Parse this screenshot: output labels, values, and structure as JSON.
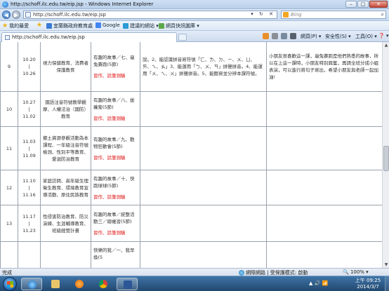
{
  "window": {
    "title": "http://schoff.ilc.edu.tw/eip.jsp - Windows Internet Explorer",
    "minimize": "–",
    "maximize": "□",
    "close": "✕"
  },
  "address_bar": {
    "url": "http://schoff.ilc.edu.tw/eip.jsp",
    "arrows": "▾ ↻ ✕",
    "search_placeholder": "Bing",
    "search_icon": "magnifier-icon"
  },
  "favorites_bar": {
    "favorites_label": "我的最愛",
    "items": [
      "宜蘭縣政府教育處",
      "Google",
      "建議的網站 ▾",
      "網頁快訊圖庫 ▾"
    ]
  },
  "tab": {
    "label": "http://schoff.ilc.edu.tw/eip.jsp"
  },
  "command_bar": {
    "page": "網頁(P) ▾",
    "safety": "安全性(S) ▾",
    "tools": "工具(O) ▾",
    "help": "❓ ▾"
  },
  "table": {
    "rows": [
      {
        "week": "9",
        "date_start": "10.20",
        "date_sep": "|",
        "date_end": "10.26",
        "topic": "視力保健教育、消費者保護教育",
        "unit": "有趣的故事／七、龜兔賽跑(5節)",
        "mark": "習作、話筆測驗",
        "notes": "說。2、能認識拼音寫符號「ㄈ、ㄌ、ㄉ、ㄧ、ㄨ、ㄩ、ㄞ、ㄟ、ㄠ」3、能運用「ㄅ、ㄨ、ㄢ」拼聲拼音。4、能運用「ㄨ、ㄟ、ㄨ」拼聲拼音。5、能聽寫並分辨本課符號。",
        "remark": "小朋友很喜歡這一課，龜兔賽跑是他們熟悉的故事，所以在上這一課時，小朋友特別興奮，再請全班分成小組表演，可以進行將句子寫出，希望小朋友與老師一起加油!"
      },
      {
        "week": "10",
        "date_start": "10.27",
        "date_sep": "|",
        "date_end": "11.02",
        "topic": "國語注音符號教學觀摩、人權法治（國防）教育",
        "unit": "有趣的故事／八、拔蘿蔔(5節)",
        "mark": "習作、話筆測驗",
        "notes": "",
        "remark": ""
      },
      {
        "week": "11",
        "date_start": "11.03",
        "date_sep": "|",
        "date_end": "11.09",
        "topic": "鄉土資源參觀活動為本課程、一年級注音符號檢測、性別平等教育、愛滋防治教育",
        "unit": "有趣的故事／九、動物狂歡會(5節)",
        "mark": "習作、話筆測驗",
        "notes": "",
        "remark": ""
      },
      {
        "week": "12",
        "date_start": "11.10",
        "date_sep": "|",
        "date_end": "11.16",
        "topic": "家庭訪問、高年級生理衛生教育、環境教育宣導活動、原住民族教育",
        "unit": "有趣的故事／十、快跑球球(5節)",
        "mark": "習作、話筆測驗",
        "notes": "",
        "remark": ""
      },
      {
        "week": "13",
        "date_start": "11.17",
        "date_sep": "|",
        "date_end": "11.23",
        "topic": "性侵害防治教育、防災演練、生涯輔導教育、班級經營計畫",
        "unit": "有趣的故事／統整活動三／總複習(5節)",
        "mark": "習作、話筆測驗",
        "notes": "",
        "remark": ""
      },
      {
        "week": "",
        "date_start": "",
        "date_sep": "",
        "date_end": "",
        "topic": "",
        "unit": "快樂的我／一、我早換(5",
        "mark": "",
        "notes": "",
        "remark": ""
      }
    ]
  },
  "status_bar": {
    "done": "完成",
    "zone": "網際網路 | 受保護模式: 啟動",
    "zoom": "🔍 100% ▾"
  },
  "taskbar": {
    "tray_icons": "▲ 🔊 📶",
    "time": "上午 09:25",
    "date": "2014/3/7"
  },
  "colors": {
    "mark_red": "#d11111",
    "taskbar": "#2a527c",
    "table_border": "#9aa3ad"
  }
}
